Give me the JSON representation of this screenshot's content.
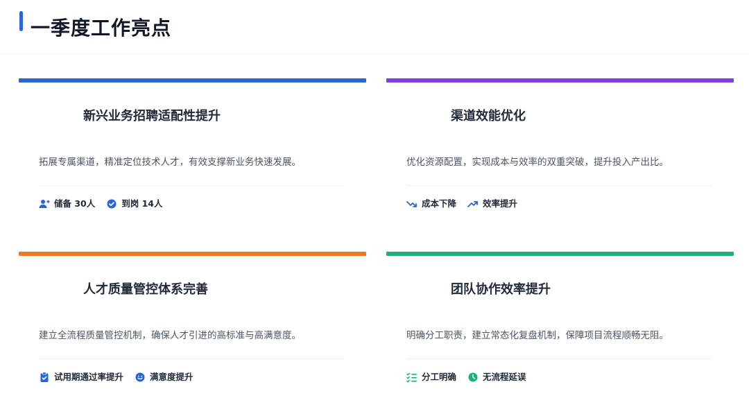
{
  "page": {
    "title": "一季度工作亮点",
    "accent_color": "#2b63d9"
  },
  "cards": [
    {
      "title": "新兴业务招聘适配性提升",
      "description": "拓展专属渠道，精准定位技术人才，有效支撑新业务快速发展。",
      "accent_color": "#2b63d9",
      "tags": [
        {
          "icon": "user-add-icon",
          "label": "储备 30人"
        },
        {
          "icon": "check-circle-icon",
          "label": "到岗 14人"
        }
      ]
    },
    {
      "title": "渠道效能优化",
      "description": "优化资源配置，实现成本与效率的双重突破，提升投入产出比。",
      "accent_color": "#7b3fe4",
      "tags": [
        {
          "icon": "trending-down-icon",
          "label": "成本下降"
        },
        {
          "icon": "trending-up-icon",
          "label": "效率提升"
        }
      ]
    },
    {
      "title": "人才质量管控体系完善",
      "description": "建立全流程质量管控机制，确保人才引进的高标准与高满意度。",
      "accent_color": "#f0781e",
      "tags": [
        {
          "icon": "clipboard-check-icon",
          "label": "试用期通过率提升"
        },
        {
          "icon": "smile-face-icon",
          "label": "满意度提升"
        }
      ]
    },
    {
      "title": "团队协作效率提升",
      "description": "明确分工职责，建立常态化复盘机制，保障项目流程顺畅无阻。",
      "accent_color": "#19b07b",
      "tags": [
        {
          "icon": "checklist-icon",
          "label": "分工明确"
        },
        {
          "icon": "clock-icon",
          "label": "无流程延误"
        }
      ]
    }
  ]
}
